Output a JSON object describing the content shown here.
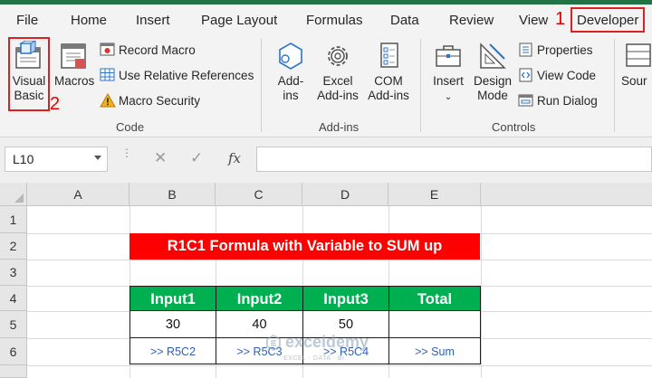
{
  "menu": {
    "tabs": [
      "File",
      "Home",
      "Insert",
      "Page Layout",
      "Formulas",
      "Data",
      "Review",
      "View",
      "Developer"
    ],
    "annotation_developer": "1",
    "annotation_visual_basic": "2"
  },
  "ribbon": {
    "code": {
      "label": "Code",
      "visual_basic": [
        "Visual",
        "Basic"
      ],
      "macros": "Macros",
      "record_macro": "Record Macro",
      "use_relative": "Use Relative References",
      "macro_security": "Macro Security"
    },
    "addins": {
      "label": "Add-ins",
      "addins": [
        "Add-",
        "ins"
      ],
      "excel_addins": [
        "Excel",
        "Add-ins"
      ],
      "com_addins": [
        "COM",
        "Add-ins"
      ]
    },
    "controls": {
      "label": "Controls",
      "insert": "Insert",
      "design_mode": [
        "Design",
        "Mode"
      ],
      "properties": "Properties",
      "view_code": "View Code",
      "run_dialog": "Run Dialog"
    },
    "source": "Sour"
  },
  "formula_bar": {
    "name_box": "L10",
    "fx": "fx",
    "cancel": "✕",
    "enter": "✓",
    "formula": ""
  },
  "sheet": {
    "columns": [
      "A",
      "B",
      "C",
      "D",
      "E"
    ],
    "rows": [
      "1",
      "2",
      "3",
      "4",
      "5",
      "6"
    ],
    "title": "R1C1 Formula with Variable to SUM up",
    "headers": [
      "Input1",
      "Input2",
      "Input3",
      "Total"
    ],
    "values": [
      "30",
      "40",
      "50",
      ""
    ],
    "links": [
      ">> R5C2",
      ">> R5C3",
      ">> R5C4",
      ">> Sum"
    ]
  },
  "watermark": {
    "brand": "exceldemy",
    "tagline": "EXCEL · DATA · BI"
  },
  "colors": {
    "excel_green": "#217346",
    "table_header_green": "#00b050",
    "title_red": "#ff0000",
    "annotation_red": "#e00000",
    "link_blue": "#2e5fb4"
  }
}
